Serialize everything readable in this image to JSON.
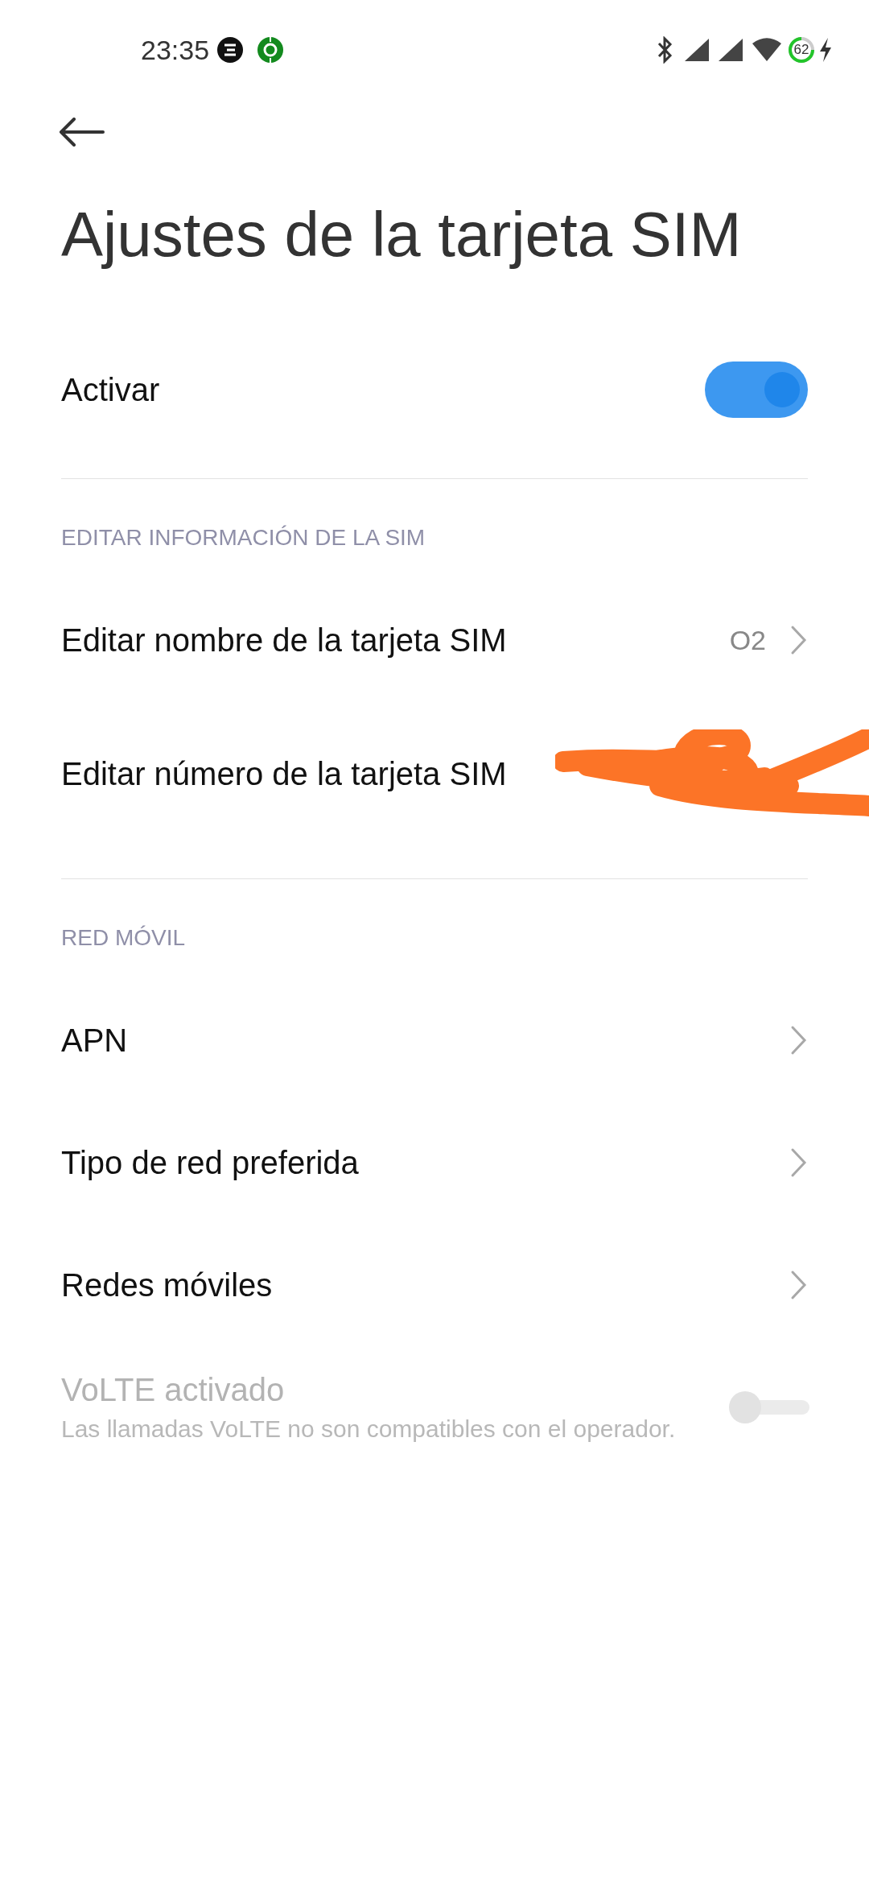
{
  "status_bar": {
    "time": "23:35",
    "battery": "62"
  },
  "title": "Ajustes de la tarjeta SIM",
  "sections": [
    {
      "items": [
        {
          "kind": "toggle",
          "label": "Activar",
          "on": true,
          "disabled": false
        }
      ]
    },
    {
      "header": "EDITAR INFORMACIÓN DE LA SIM",
      "items": [
        {
          "kind": "link",
          "label": "Editar nombre de la tarjeta SIM",
          "value": "O2"
        },
        {
          "kind": "redacted",
          "label": "Editar número de la tarjeta SIM"
        }
      ]
    },
    {
      "header": "RED MÓVIL",
      "items": [
        {
          "kind": "link",
          "label": "APN"
        },
        {
          "kind": "link",
          "label": "Tipo de red preferida"
        },
        {
          "kind": "link",
          "label": "Redes móviles"
        },
        {
          "kind": "toggle",
          "label": "VoLTE activado",
          "description": "Las llamadas VoLTE no son compatibles con el operador.",
          "on": false,
          "disabled": true
        }
      ]
    }
  ]
}
